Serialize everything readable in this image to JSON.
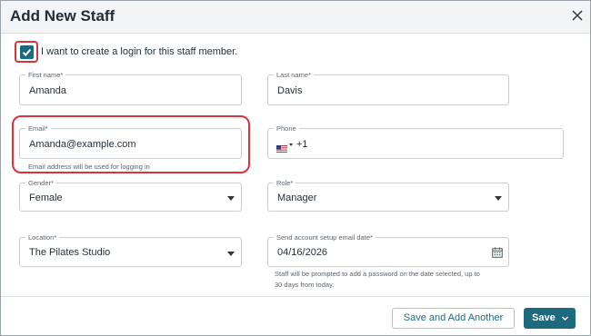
{
  "dialog": {
    "title": "Add New Staff"
  },
  "login_checkbox": {
    "checked": true,
    "label": "I want to create a login for this staff member."
  },
  "form": {
    "first_name": {
      "label": "First name*",
      "value": "Amanda"
    },
    "last_name": {
      "label": "Last name*",
      "value": "Davis"
    },
    "email": {
      "label": "Email*",
      "value": "Amanda@example.com",
      "hint": "Email address will be used for logging in"
    },
    "phone": {
      "label": "Phone",
      "country_code": "+1",
      "country_flag": "us-flag-icon"
    },
    "gender": {
      "label": "Gender*",
      "value": "Female"
    },
    "role": {
      "label": "Role*",
      "value": "Manager"
    },
    "location": {
      "label": "Location*",
      "value": "The Pilates Studio"
    },
    "setup_email_date": {
      "label": "Send account setup email date*",
      "value": "04/16/2026",
      "hint_line1": "Staff will be prompted to add a password on the date selected, up to",
      "hint_line2": "30 days from today."
    }
  },
  "footer": {
    "secondary_button": "Save and Add Another",
    "primary_button": "Save"
  },
  "colors": {
    "accent": "#1d6a7f",
    "highlight": "#d9343c"
  }
}
